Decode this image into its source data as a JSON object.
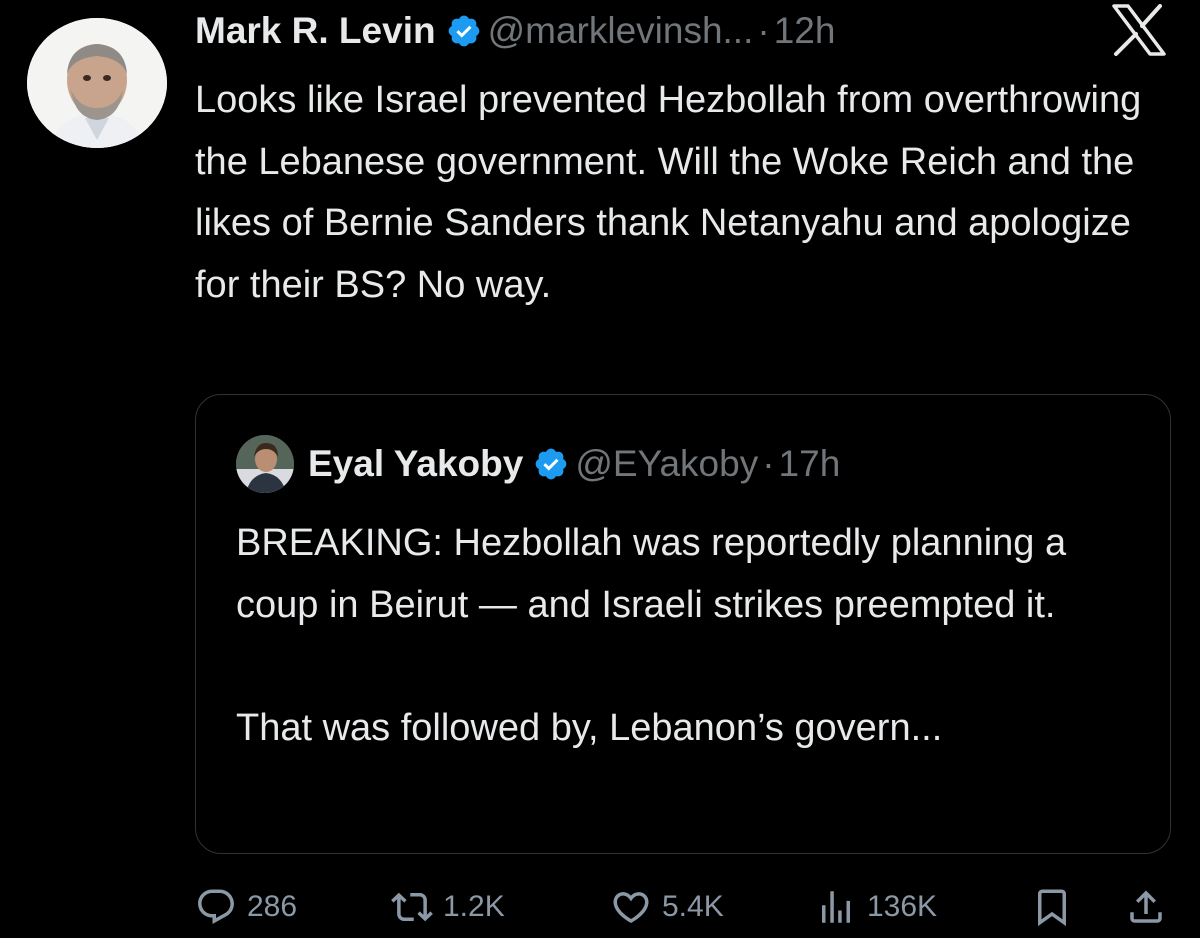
{
  "tweet": {
    "author_name": "Mark R. Levin",
    "handle": "@marklevinsh...",
    "separator": "·",
    "time": "12h",
    "text": "Looks like Israel prevented Hezbollah from overthrowing the Lebanese government.  Will the Woke Reich and the likes of Bernie Sanders thank Netanyahu and apologize for their BS?  No way."
  },
  "quote": {
    "author_name": "Eyal Yakoby",
    "handle": "@EYakoby",
    "separator": "·",
    "time": "17h",
    "paragraphs": [
      "BREAKING: Hezbollah was reportedly planning a coup in Beirut — and Israeli strikes preempted it.",
      "That was followed by, Lebanon’s govern..."
    ]
  },
  "actions": {
    "replies": "286",
    "retweets": "1.2K",
    "likes": "5.4K",
    "views": "136K"
  },
  "icons": {
    "verified": "verified-badge-icon",
    "platform_logo": "x-logo-icon",
    "reply": "reply-icon",
    "retweet": "retweet-icon",
    "like": "heart-icon",
    "views": "views-icon",
    "bookmark": "bookmark-icon",
    "share": "share-icon"
  },
  "colors": {
    "background": "#000000",
    "text": "#e7e9ea",
    "secondary": "#71767b",
    "action": "#8b98a5",
    "verified": "#1d9bf0",
    "border": "#2f3336"
  }
}
